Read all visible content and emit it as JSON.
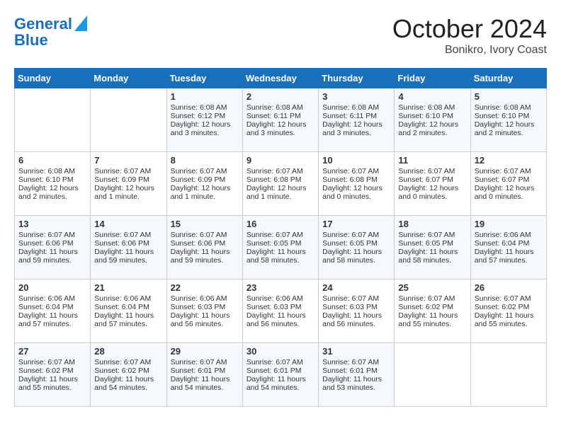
{
  "header": {
    "logo_line1": "General",
    "logo_line2": "Blue",
    "month": "October 2024",
    "location": "Bonikro, Ivory Coast"
  },
  "weekdays": [
    "Sunday",
    "Monday",
    "Tuesday",
    "Wednesday",
    "Thursday",
    "Friday",
    "Saturday"
  ],
  "weeks": [
    [
      {
        "day": "",
        "info": ""
      },
      {
        "day": "",
        "info": ""
      },
      {
        "day": "1",
        "info": "Sunrise: 6:08 AM\nSunset: 6:12 PM\nDaylight: 12 hours and 3 minutes."
      },
      {
        "day": "2",
        "info": "Sunrise: 6:08 AM\nSunset: 6:11 PM\nDaylight: 12 hours and 3 minutes."
      },
      {
        "day": "3",
        "info": "Sunrise: 6:08 AM\nSunset: 6:11 PM\nDaylight: 12 hours and 3 minutes."
      },
      {
        "day": "4",
        "info": "Sunrise: 6:08 AM\nSunset: 6:10 PM\nDaylight: 12 hours and 2 minutes."
      },
      {
        "day": "5",
        "info": "Sunrise: 6:08 AM\nSunset: 6:10 PM\nDaylight: 12 hours and 2 minutes."
      }
    ],
    [
      {
        "day": "6",
        "info": "Sunrise: 6:08 AM\nSunset: 6:10 PM\nDaylight: 12 hours and 2 minutes."
      },
      {
        "day": "7",
        "info": "Sunrise: 6:07 AM\nSunset: 6:09 PM\nDaylight: 12 hours and 1 minute."
      },
      {
        "day": "8",
        "info": "Sunrise: 6:07 AM\nSunset: 6:09 PM\nDaylight: 12 hours and 1 minute."
      },
      {
        "day": "9",
        "info": "Sunrise: 6:07 AM\nSunset: 6:08 PM\nDaylight: 12 hours and 1 minute."
      },
      {
        "day": "10",
        "info": "Sunrise: 6:07 AM\nSunset: 6:08 PM\nDaylight: 12 hours and 0 minutes."
      },
      {
        "day": "11",
        "info": "Sunrise: 6:07 AM\nSunset: 6:07 PM\nDaylight: 12 hours and 0 minutes."
      },
      {
        "day": "12",
        "info": "Sunrise: 6:07 AM\nSunset: 6:07 PM\nDaylight: 12 hours and 0 minutes."
      }
    ],
    [
      {
        "day": "13",
        "info": "Sunrise: 6:07 AM\nSunset: 6:06 PM\nDaylight: 11 hours and 59 minutes."
      },
      {
        "day": "14",
        "info": "Sunrise: 6:07 AM\nSunset: 6:06 PM\nDaylight: 11 hours and 59 minutes."
      },
      {
        "day": "15",
        "info": "Sunrise: 6:07 AM\nSunset: 6:06 PM\nDaylight: 11 hours and 59 minutes."
      },
      {
        "day": "16",
        "info": "Sunrise: 6:07 AM\nSunset: 6:05 PM\nDaylight: 11 hours and 58 minutes."
      },
      {
        "day": "17",
        "info": "Sunrise: 6:07 AM\nSunset: 6:05 PM\nDaylight: 11 hours and 58 minutes."
      },
      {
        "day": "18",
        "info": "Sunrise: 6:07 AM\nSunset: 6:05 PM\nDaylight: 11 hours and 58 minutes."
      },
      {
        "day": "19",
        "info": "Sunrise: 6:06 AM\nSunset: 6:04 PM\nDaylight: 11 hours and 57 minutes."
      }
    ],
    [
      {
        "day": "20",
        "info": "Sunrise: 6:06 AM\nSunset: 6:04 PM\nDaylight: 11 hours and 57 minutes."
      },
      {
        "day": "21",
        "info": "Sunrise: 6:06 AM\nSunset: 6:04 PM\nDaylight: 11 hours and 57 minutes."
      },
      {
        "day": "22",
        "info": "Sunrise: 6:06 AM\nSunset: 6:03 PM\nDaylight: 11 hours and 56 minutes."
      },
      {
        "day": "23",
        "info": "Sunrise: 6:06 AM\nSunset: 6:03 PM\nDaylight: 11 hours and 56 minutes."
      },
      {
        "day": "24",
        "info": "Sunrise: 6:07 AM\nSunset: 6:03 PM\nDaylight: 11 hours and 56 minutes."
      },
      {
        "day": "25",
        "info": "Sunrise: 6:07 AM\nSunset: 6:02 PM\nDaylight: 11 hours and 55 minutes."
      },
      {
        "day": "26",
        "info": "Sunrise: 6:07 AM\nSunset: 6:02 PM\nDaylight: 11 hours and 55 minutes."
      }
    ],
    [
      {
        "day": "27",
        "info": "Sunrise: 6:07 AM\nSunset: 6:02 PM\nDaylight: 11 hours and 55 minutes."
      },
      {
        "day": "28",
        "info": "Sunrise: 6:07 AM\nSunset: 6:02 PM\nDaylight: 11 hours and 54 minutes."
      },
      {
        "day": "29",
        "info": "Sunrise: 6:07 AM\nSunset: 6:01 PM\nDaylight: 11 hours and 54 minutes."
      },
      {
        "day": "30",
        "info": "Sunrise: 6:07 AM\nSunset: 6:01 PM\nDaylight: 11 hours and 54 minutes."
      },
      {
        "day": "31",
        "info": "Sunrise: 6:07 AM\nSunset: 6:01 PM\nDaylight: 11 hours and 53 minutes."
      },
      {
        "day": "",
        "info": ""
      },
      {
        "day": "",
        "info": ""
      }
    ]
  ]
}
